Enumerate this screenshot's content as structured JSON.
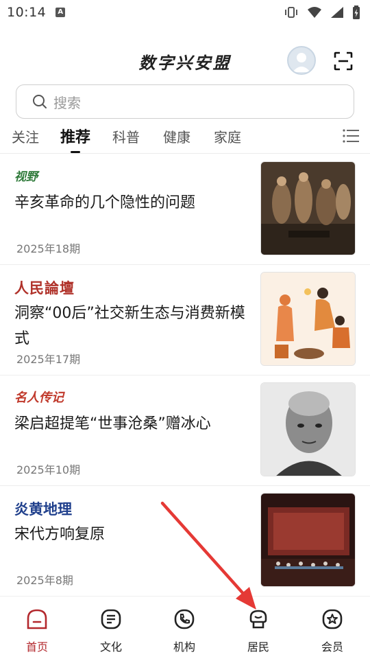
{
  "status_bar": {
    "time": "10:14",
    "notification_glyph": "A"
  },
  "header": {
    "title": "数字兴安盟"
  },
  "search": {
    "placeholder": "搜索"
  },
  "tabs": [
    {
      "label": "关注"
    },
    {
      "label": "推荐",
      "active": true
    },
    {
      "label": "科普"
    },
    {
      "label": "健康"
    },
    {
      "label": "家庭"
    }
  ],
  "articles": [
    {
      "source": "视野",
      "title": "辛亥革命的几个隐性的问题",
      "date": "2025年18期"
    },
    {
      "source": "人民論壇",
      "title": "洞察“00后”社交新生态与消费新模式",
      "date": "2025年17期"
    },
    {
      "source": "名人传记",
      "title": "梁启超提笔“世事沧桑”赠冰心",
      "date": "2025年10期"
    },
    {
      "source": "炎黄地理",
      "title": "宋代方响复原",
      "date": "2025年8期"
    }
  ],
  "bottom_nav": [
    {
      "label": "首页",
      "icon": "home-icon",
      "active": true
    },
    {
      "label": "文化",
      "icon": "culture-icon"
    },
    {
      "label": "机构",
      "icon": "phone-icon"
    },
    {
      "label": "居民",
      "icon": "resident-icon"
    },
    {
      "label": "会员",
      "icon": "member-star-icon"
    }
  ],
  "colors": {
    "accent": "#b3282d",
    "annotation_arrow": "#e53935"
  }
}
